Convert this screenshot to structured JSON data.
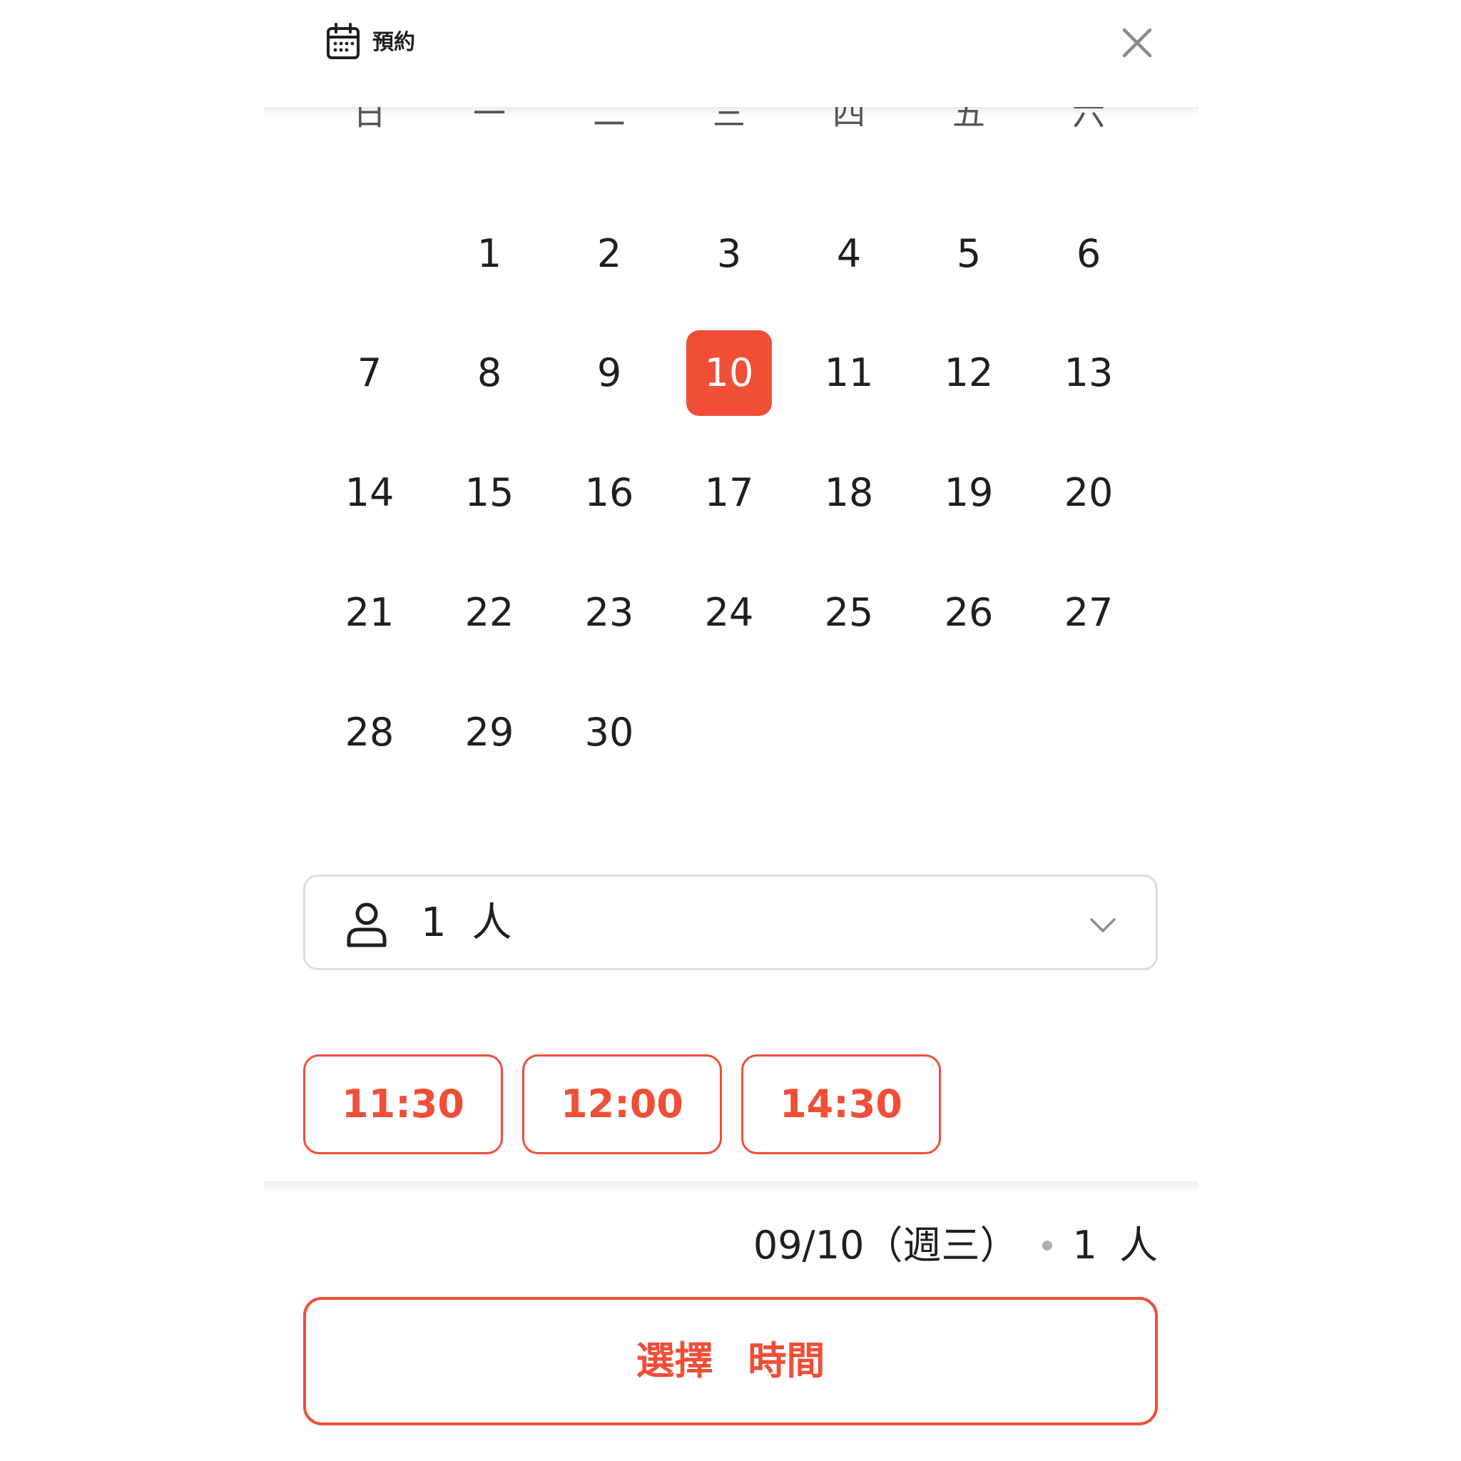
{
  "header": {
    "icon": "calendar-icon",
    "title": "預約",
    "close_icon": "close-icon"
  },
  "calendar": {
    "weekdays": [
      "日",
      "一",
      "二",
      "三",
      "四",
      "五",
      "六"
    ],
    "weeks": [
      [
        "",
        "1",
        "2",
        "3",
        "4",
        "5",
        "6"
      ],
      [
        "7",
        "8",
        "9",
        "10",
        "11",
        "12",
        "13"
      ],
      [
        "14",
        "15",
        "16",
        "17",
        "18",
        "19",
        "20"
      ],
      [
        "21",
        "22",
        "23",
        "24",
        "25",
        "26",
        "27"
      ],
      [
        "28",
        "29",
        "30",
        "",
        "",
        "",
        ""
      ]
    ],
    "selected_day": "10"
  },
  "party": {
    "icon": "person-icon",
    "value": "1 人",
    "dropdown_icon": "chevron-down-icon"
  },
  "times": [
    "11:30",
    "12:00",
    "14:30"
  ],
  "summary": {
    "date": "09/10（週三）",
    "party": "1 人"
  },
  "cta": {
    "label": "選擇 時間"
  },
  "colors": {
    "accent": "#f04e37",
    "border": "#dddddd",
    "text": "#1f1f1f"
  }
}
